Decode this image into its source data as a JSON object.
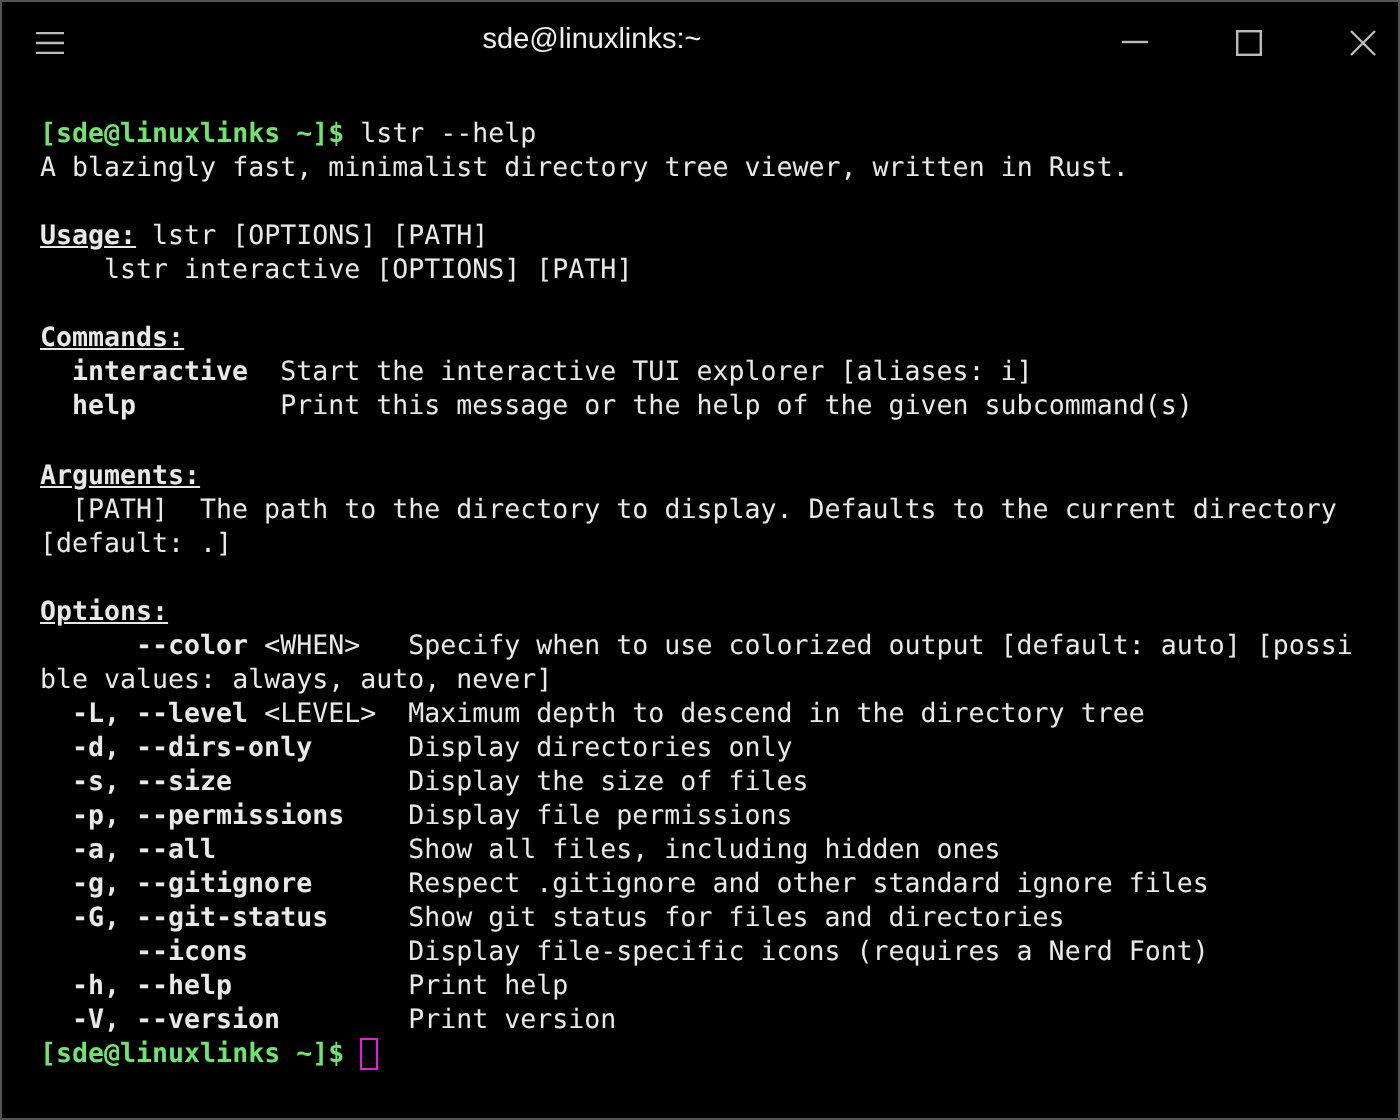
{
  "window": {
    "title": "sde@linuxlinks:~"
  },
  "terminal": {
    "lines": [
      {
        "kind": "blank"
      },
      {
        "kind": "prompt",
        "prompt": "[sde@linuxlinks ~]$",
        "command": "lstr --help"
      },
      {
        "kind": "text",
        "text": "A blazingly fast, minimalist directory tree viewer, written in Rust."
      },
      {
        "kind": "blank"
      },
      {
        "kind": "usage",
        "label": "Usage:",
        "text": "lstr [OPTIONS] [PATH]"
      },
      {
        "kind": "usage_more",
        "text": "lstr interactive [OPTIONS] [PATH]"
      },
      {
        "kind": "blank"
      },
      {
        "kind": "heading",
        "text": "Commands:"
      },
      {
        "kind": "command",
        "name": "interactive",
        "description": "Start the interactive TUI explorer [aliases: i]"
      },
      {
        "kind": "command",
        "name": "help",
        "description": "Print this message or the help of the given subcommand(s)"
      },
      {
        "kind": "blank"
      },
      {
        "kind": "heading",
        "text": "Arguments:"
      },
      {
        "kind": "argument",
        "name": "[PATH]",
        "description": "The path to the directory to display. Defaults to the current directory"
      },
      {
        "kind": "text",
        "text": "[default: .]"
      },
      {
        "kind": "blank"
      },
      {
        "kind": "heading",
        "text": "Options:"
      },
      {
        "kind": "option",
        "long": "--color",
        "value": "<WHEN>",
        "description": "Specify when to use colorized output [default: auto] [possi"
      },
      {
        "kind": "text",
        "text": "ble values: always, auto, never]"
      },
      {
        "kind": "option",
        "short": "-L,",
        "long": "--level",
        "value": "<LEVEL>",
        "description": "Maximum depth to descend in the directory tree"
      },
      {
        "kind": "option",
        "short": "-d,",
        "long": "--dirs-only",
        "description": "Display directories only"
      },
      {
        "kind": "option",
        "short": "-s,",
        "long": "--size",
        "description": "Display the size of files"
      },
      {
        "kind": "option",
        "short": "-p,",
        "long": "--permissions",
        "description": "Display file permissions"
      },
      {
        "kind": "option",
        "short": "-a,",
        "long": "--all",
        "description": "Show all files, including hidden ones"
      },
      {
        "kind": "option",
        "short": "-g,",
        "long": "--gitignore",
        "description": "Respect .gitignore and other standard ignore files"
      },
      {
        "kind": "option",
        "short": "-G,",
        "long": "--git-status",
        "description": "Show git status for files and directories"
      },
      {
        "kind": "option",
        "long": "--icons",
        "description": "Display file-specific icons (requires a Nerd Font)"
      },
      {
        "kind": "option",
        "short": "-h,",
        "long": "--help",
        "description": "Print help"
      },
      {
        "kind": "option",
        "short": "-V,",
        "long": "--version",
        "description": "Print version"
      },
      {
        "kind": "prompt",
        "prompt": "[sde@linuxlinks ~]$",
        "cursor": true
      }
    ]
  }
}
